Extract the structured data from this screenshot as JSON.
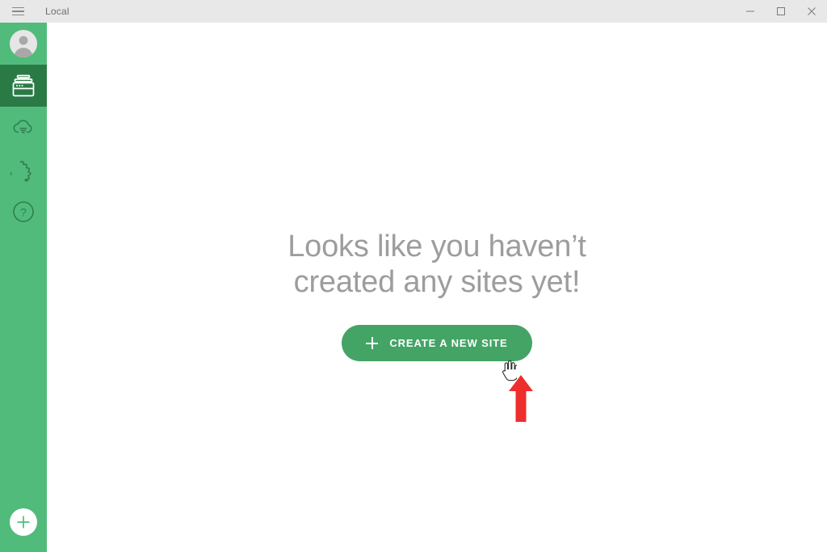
{
  "window": {
    "title": "Local",
    "menu_icon": "hamburger-icon",
    "controls": {
      "minimize": "minimize-icon",
      "maximize": "maximize-icon",
      "close": "close-icon"
    }
  },
  "sidebar": {
    "background_color": "#51bb7b",
    "active_color": "#2a7a46",
    "items": [
      {
        "name": "account",
        "icon": "avatar-icon",
        "active": false
      },
      {
        "name": "sites",
        "icon": "sites-window-icon",
        "active": true
      },
      {
        "name": "connect",
        "icon": "cloud-download-icon",
        "active": false
      },
      {
        "name": "add-ons",
        "icon": "puzzle-piece-icon",
        "active": false
      },
      {
        "name": "help",
        "icon": "question-circle-icon",
        "active": false
      }
    ],
    "add_button": {
      "icon": "plus-circle-icon",
      "label": "Add"
    }
  },
  "main": {
    "empty_state": {
      "heading_line1": "Looks like you haven’t",
      "heading_line2": "created any sites yet!",
      "heading_color": "#9d9d9d",
      "button_label": "CREATE A NEW SITE",
      "button_icon": "plus-icon",
      "button_color": "#43a465"
    }
  },
  "overlays": {
    "cursor": "pointer-hand-cursor",
    "annotation_arrow": {
      "name": "red-arrow-annotation",
      "color": "#ee2d2d",
      "direction": "up"
    }
  }
}
